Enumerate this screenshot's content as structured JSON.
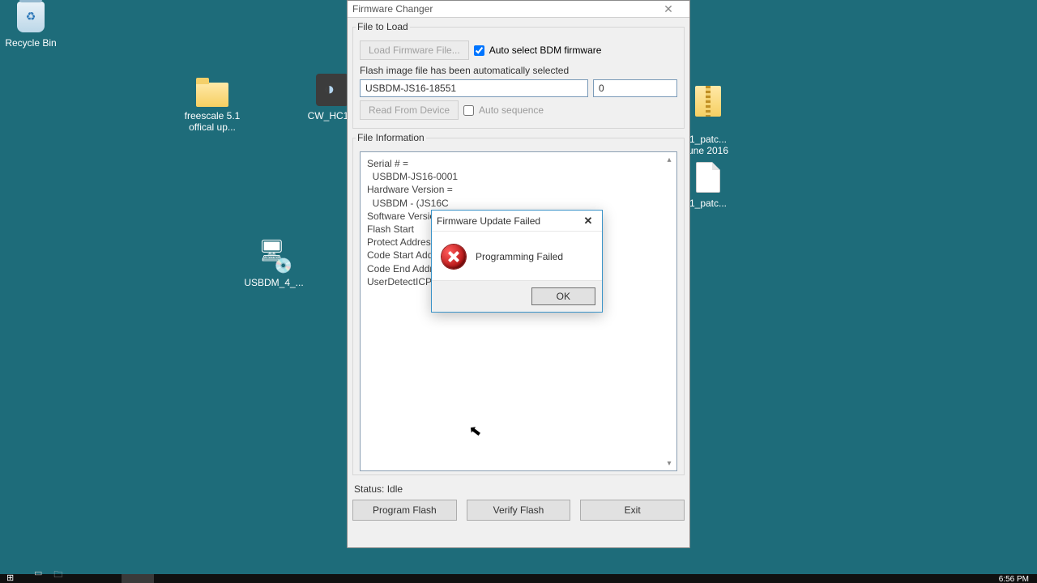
{
  "desktop": {
    "recycle_bin": "Recycle Bin",
    "freescale": "freescale 5.1 offical up...",
    "cw_hc1": "CW_HC1...",
    "usbdm": "USBDM_4_...",
    "zip1": "1_patc...\nune 2016",
    "zip2": "1_patc..."
  },
  "window": {
    "title": "Firmware Changer",
    "group_load": "File to Load",
    "btn_load": "Load Firmware File...",
    "chk_autobdm": "Auto select BDM firmware",
    "msg_autoselected": "Flash image file has been automatically selected",
    "field_device": "USBDM-JS16-18551",
    "field_num": "0",
    "btn_readdev": "Read From Device",
    "chk_autoseq": "Auto sequence",
    "group_info": "File Information",
    "info_text": "Serial # =\n  USBDM-JS16-0001\nHardware Version =\n  USBDM - (JS16C\nSoftware Version\nFlash Start\nProtect Address\nCode Start Addres\nCode End Address\nUserDetectICP()",
    "status": "Status: Idle",
    "btn_program": "Program Flash",
    "btn_verify": "Verify Flash",
    "btn_exit": "Exit"
  },
  "dialog": {
    "title": "Firmware Update Failed",
    "message": "Programming Failed",
    "ok": "OK"
  },
  "taskbar": {
    "clock": "6:56 PM"
  }
}
